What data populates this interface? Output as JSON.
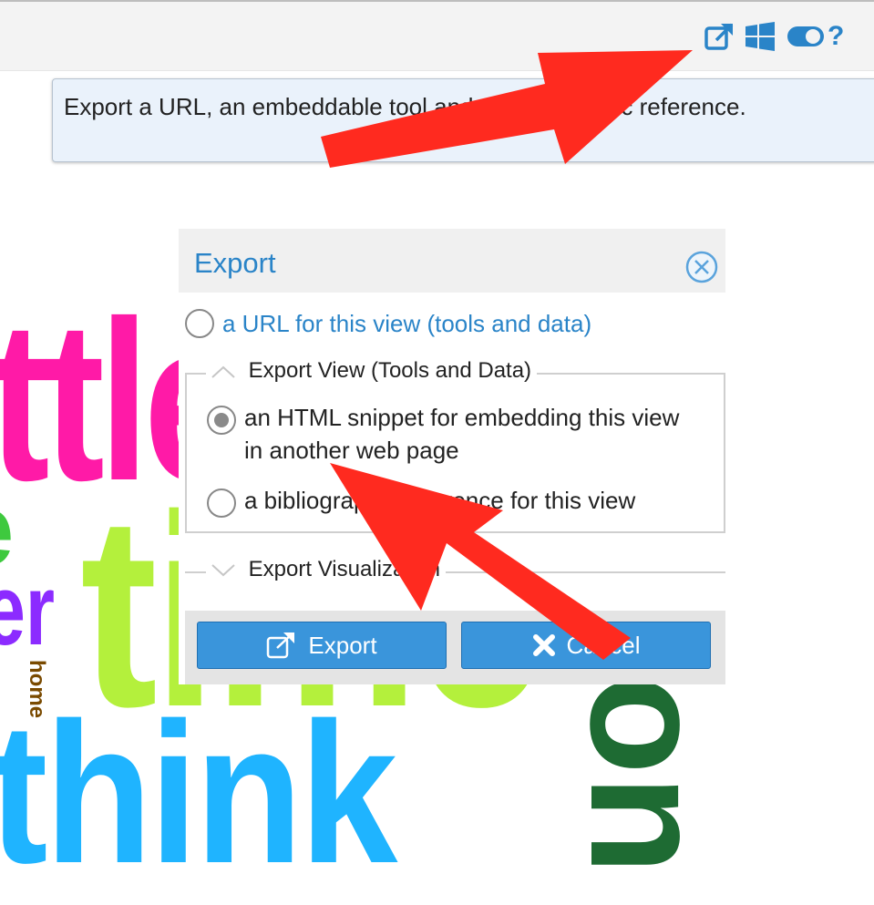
{
  "toolbar": {
    "icons": [
      "export-icon",
      "windows-icon",
      "toggle-icon",
      "help-icon"
    ],
    "help_label": "?"
  },
  "tooltip": {
    "text": "Export a URL, an embeddable tool and a bibliographic reference."
  },
  "word_cloud": {
    "words": [
      {
        "text": "ttle",
        "color": "#ff1aa7"
      },
      {
        "text": "e",
        "color": "#3ec93e"
      },
      {
        "text": "er",
        "color": "#8c2bff"
      },
      {
        "text": "home",
        "color": "#7a4a00"
      },
      {
        "text": "time",
        "color": "#b4f03c"
      },
      {
        "text": "think",
        "color": "#1fb4ff"
      },
      {
        "text": "on",
        "color": "#1e6b33"
      }
    ]
  },
  "dialog": {
    "title": "Export",
    "option_url": "a URL for this view (tools and data)",
    "section_view": {
      "legend": "Export View (Tools and Data)",
      "option_html": "an HTML snippet for embedding this view in another web page",
      "option_biblio": "a bibliographic reference for this view"
    },
    "section_visualization": {
      "legend": "Export Visualization"
    },
    "buttons": {
      "export_label": "Export",
      "cancel_label": "Cancel"
    }
  },
  "colors": {
    "accent": "#2a84c8",
    "button": "#3a95db",
    "annotation_arrow": "#ff2a1f"
  }
}
